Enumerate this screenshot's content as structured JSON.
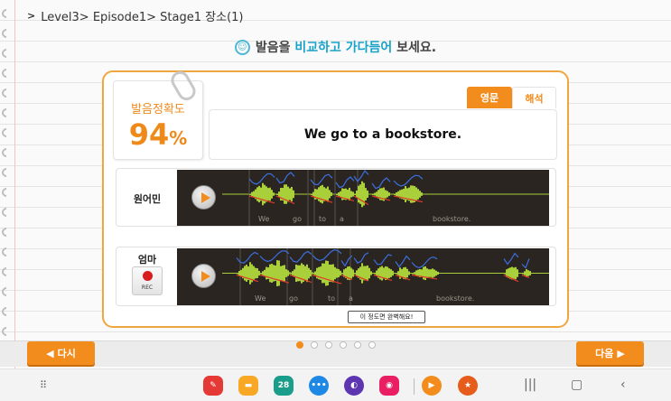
{
  "breadcrumb": {
    "text": "Level3> Episode1> Stage1 장소(1)"
  },
  "instruction": {
    "pre": "발음을 ",
    "highlight": "비교하고 가다듬어",
    "post": " 보세요."
  },
  "score": {
    "label": "발음정확도",
    "value": "94",
    "unit": "%"
  },
  "tabs": {
    "original": "영문",
    "translation": "해석"
  },
  "sentence": "We go to a bookstore.",
  "native": {
    "label": "원어민",
    "words": [
      "We",
      "go",
      "to",
      "a",
      "bookstore."
    ]
  },
  "user": {
    "label": "엄마",
    "rec_label": "REC",
    "words": [
      "We",
      "go",
      "to",
      "a",
      "bookstore."
    ]
  },
  "hint": "이 정도면 완벽해요!",
  "pagination": {
    "total": 6,
    "current": 1
  },
  "nav": {
    "back": "다시",
    "next": "다음"
  },
  "taskbar": {
    "calendar_day": "28"
  },
  "colors": {
    "accent": "#f28c1c",
    "highlight": "#1aa3c9",
    "waveform": "#a9cf3a",
    "pitch_blue": "#3b6fe0",
    "pitch_red": "#e03a2a"
  }
}
